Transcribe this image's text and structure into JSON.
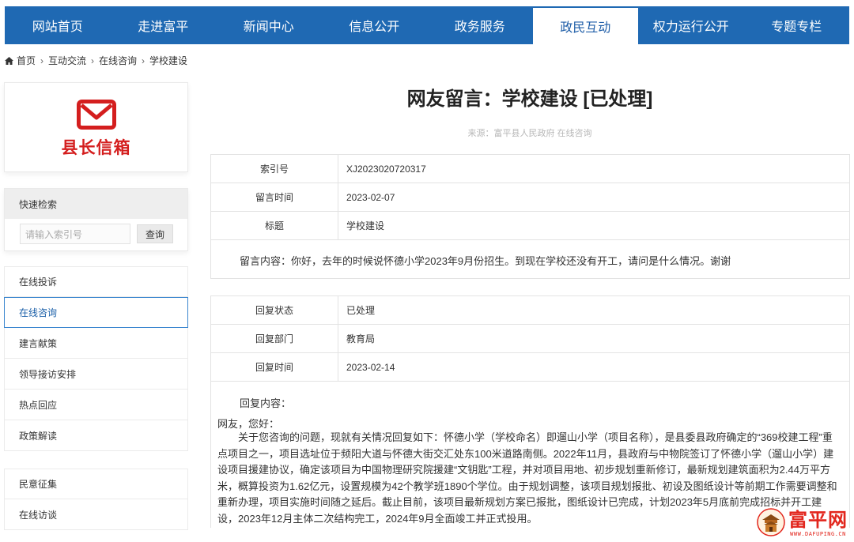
{
  "nav": {
    "items": [
      "网站首页",
      "走进富平",
      "新闻中心",
      "信息公开",
      "政务服务",
      "政民互动",
      "权力运行公开",
      "专题专栏"
    ],
    "active_index": 5
  },
  "breadcrumb": {
    "items": [
      "首页",
      "互动交流",
      "在线咨询",
      "学校建设"
    ]
  },
  "sidebar": {
    "mailbox_title": "县长信箱",
    "quick_search": {
      "title": "快速检索",
      "placeholder": "请输入索引号",
      "button": "查询"
    },
    "menu": [
      "在线投诉",
      "在线咨询",
      "建言献策",
      "领导接访安排",
      "热点回应",
      "政策解读"
    ],
    "menu_active_index": 1,
    "menu2": [
      "民意征集",
      "在线访谈"
    ]
  },
  "main": {
    "title": "网友留言：学校建设 [已处理]",
    "source": "来源：富平县人民政府 在线咨询",
    "message_table": {
      "rows": [
        {
          "key": "索引号",
          "value": "XJ2023020720317"
        },
        {
          "key": "留言时间",
          "value": "2023-02-07"
        },
        {
          "key": "标题",
          "value": "学校建设"
        }
      ],
      "content": "留言内容：你好，去年的时候说怀德小学2023年9月份招生。到现在学校还没有开工，请问是什么情况。谢谢"
    },
    "reply_table": {
      "rows": [
        {
          "key": "回复状态",
          "value": "已处理"
        },
        {
          "key": "回复部门",
          "value": "教育局"
        },
        {
          "key": "回复时间",
          "value": "2023-02-14"
        }
      ],
      "content_label": "回复内容：",
      "greeting": "网友，您好：",
      "body": "关于您咨询的问题，现就有关情况回复如下：怀德小学（学校命名）即遛山小学（项目名称），是县委县政府确定的“369校建工程”重点项目之一，项目选址位于频阳大道与怀德大街交汇处东100米道路南侧。2022年11月，县政府与中物院签订了怀德小学（遛山小学）建设项目援建协议，确定该项目为中国物理研究院援建“文钥匙”工程，并对项目用地、初步规划重新修订，最新规划建筑面积为2.44万平方米，概算投资为1.62亿元，设置规模为42个教学班1890个学位。由于规划调整，该项目规划报批、初设及图纸设计等前期工作需要调整和重新办理，项目实施时间随之延后。截止目前，该项目最新规划方案已报批，图纸设计已完成，计划2023年5月底前完成招标并开工建设，2023年12月主体二次结构完工，2024年9月全面竣工并正式投用。"
    }
  },
  "watermark": {
    "name": "富平网",
    "url": "WWW.DAFUPING.CN"
  },
  "colors": {
    "nav_bg": "#1f69b3",
    "mailbox_red": "#d41e1e",
    "active_border": "#3b86cf"
  }
}
